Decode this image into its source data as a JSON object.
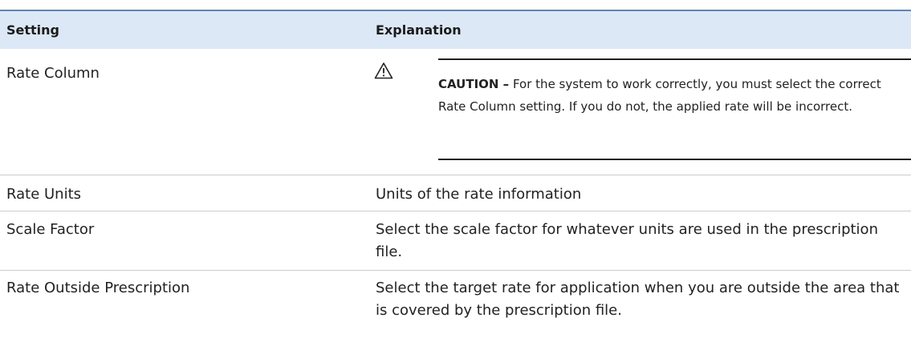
{
  "header": {
    "setting": "Setting",
    "explanation": "Explanation"
  },
  "rows": [
    {
      "setting": "Rate Column",
      "caution": {
        "icon": "warning-triangle-icon",
        "label": "CAUTION –",
        "text": "For the system to work correctly, you must select the correct Rate Column setting. If you do not, the applied rate will be incorrect."
      }
    },
    {
      "setting": "Rate Units",
      "explanation": "Units of the rate information"
    },
    {
      "setting": "Scale Factor",
      "explanation": "Select the scale factor for whatever units are used in the prescription file."
    },
    {
      "setting": "Rate Outside Prescription",
      "explanation": "Select the target rate for application when you are outside the area that is covered by the prescription file."
    }
  ],
  "colors": {
    "header_background": "#dce8f6",
    "header_top_rule": "#5e86b4",
    "row_separator": "#c9cdd3",
    "text": "#222222"
  }
}
